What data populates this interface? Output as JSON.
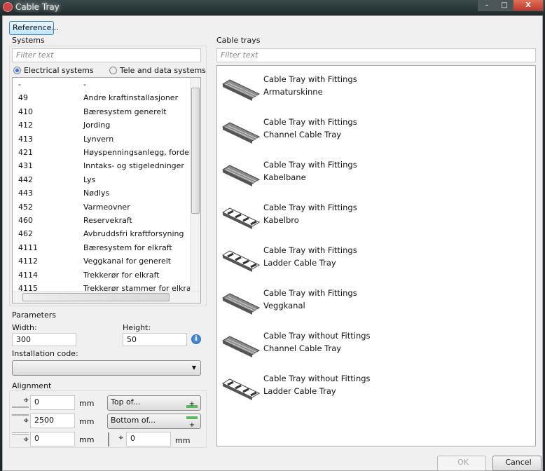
{
  "window": {
    "title": "Cable Tray",
    "minimize": "–",
    "maximize": "□",
    "close": "X"
  },
  "reference_button": "Reference...",
  "systems": {
    "label": "Systems",
    "filter_placeholder": "Filter text",
    "radio_electrical": "Electrical systems",
    "radio_tele": "Tele and data systems",
    "selected": "Electrical systems",
    "rows": [
      {
        "code": "-",
        "name": "-"
      },
      {
        "code": "49",
        "name": "Andre kraftinstallasjoner"
      },
      {
        "code": "410",
        "name": "Bæresystem generelt"
      },
      {
        "code": "412",
        "name": "Jording"
      },
      {
        "code": "413",
        "name": "Lynvern"
      },
      {
        "code": "421",
        "name": "Høyspenningsanlegg, fordeling"
      },
      {
        "code": "431",
        "name": "Inntaks- og stigeledninger"
      },
      {
        "code": "442",
        "name": "Lys"
      },
      {
        "code": "443",
        "name": "Nødlys"
      },
      {
        "code": "452",
        "name": "Varmeovner"
      },
      {
        "code": "460",
        "name": "Reservekraft"
      },
      {
        "code": "462",
        "name": "Avbruddsfri kraftforsyning"
      },
      {
        "code": "4111",
        "name": "Bæresystem for elkraft"
      },
      {
        "code": "4112",
        "name": "Veggkanal for generelt"
      },
      {
        "code": "4114",
        "name": "Trekkerør for elkraft"
      },
      {
        "code": "4115",
        "name": "Trekkerør stammer for elkraft"
      }
    ]
  },
  "parameters": {
    "label": "Parameters",
    "width_label": "Width:",
    "width_value": "300",
    "height_label": "Height:",
    "height_value": "50",
    "installation_label": "Installation code:",
    "installation_value": ""
  },
  "alignment": {
    "label": "Alignment",
    "top_offset": "0",
    "bottom_offset": "2500",
    "third_offset": "0",
    "side_offset": "0",
    "unit": "mm",
    "top_button": "Top of...",
    "bottom_button": "Bottom of..."
  },
  "cable_trays": {
    "label": "Cable trays",
    "filter_placeholder": "Filter text",
    "items": [
      {
        "type": "Cable Tray with Fittings",
        "name": "Armaturskinne",
        "icon": "channel"
      },
      {
        "type": "Cable Tray with Fittings",
        "name": "Channel Cable Tray",
        "icon": "channel"
      },
      {
        "type": "Cable Tray with Fittings",
        "name": "Kabelbane",
        "icon": "channel"
      },
      {
        "type": "Cable Tray with Fittings",
        "name": "Kabelbro",
        "icon": "ladder"
      },
      {
        "type": "Cable Tray with Fittings",
        "name": "Ladder Cable Tray",
        "icon": "ladder"
      },
      {
        "type": "Cable Tray with Fittings",
        "name": "Veggkanal",
        "icon": "channel"
      },
      {
        "type": "Cable Tray without Fittings",
        "name": "Channel Cable Tray",
        "icon": "channel"
      },
      {
        "type": "Cable Tray without Fittings",
        "name": "Ladder Cable Tray",
        "icon": "ladder"
      }
    ]
  },
  "footer": {
    "ok": "OK",
    "cancel": "Cancel"
  }
}
